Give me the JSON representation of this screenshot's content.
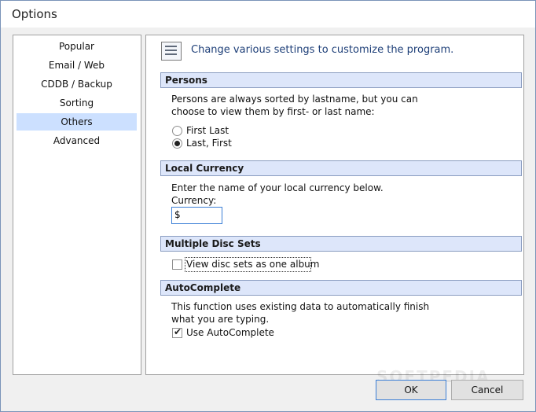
{
  "window": {
    "title": "Options"
  },
  "sidebar": {
    "items": [
      {
        "label": "Popular",
        "selected": false
      },
      {
        "label": "Email / Web",
        "selected": false
      },
      {
        "label": "CDDB / Backup",
        "selected": false
      },
      {
        "label": "Sorting",
        "selected": false
      },
      {
        "label": "Others",
        "selected": true
      },
      {
        "label": "Advanced",
        "selected": false
      }
    ]
  },
  "main": {
    "header_icon": "list-settings-icon",
    "header_text": "Change various settings to customize the program.",
    "persons": {
      "heading": "Persons",
      "description_line1": "Persons are always sorted by lastname, but you can",
      "description_line2": "choose to view them by first- or last name:",
      "options": [
        {
          "label": "First Last",
          "checked": false
        },
        {
          "label": "Last, First",
          "checked": true
        }
      ]
    },
    "local_currency": {
      "heading": "Local Currency",
      "description": "Enter the name of your local currency below.",
      "field_label": "Currency:",
      "value": "$"
    },
    "multiple_disc_sets": {
      "heading": "Multiple Disc Sets",
      "checkbox_label": "View disc sets as one album",
      "checked": false
    },
    "autocomplete": {
      "heading": "AutoComplete",
      "description_line1": "This function uses existing data to automatically finish",
      "description_line2": "what you are typing.",
      "checkbox_label": "Use AutoComplete",
      "checked": true
    }
  },
  "buttons": {
    "ok": "OK",
    "cancel": "Cancel"
  },
  "watermark": "SOFTPEDIA",
  "colors": {
    "accent": "#3c7fd6",
    "selection": "#cce0ff",
    "section_header": "#dde6fa",
    "header_text": "#1e3f78"
  }
}
